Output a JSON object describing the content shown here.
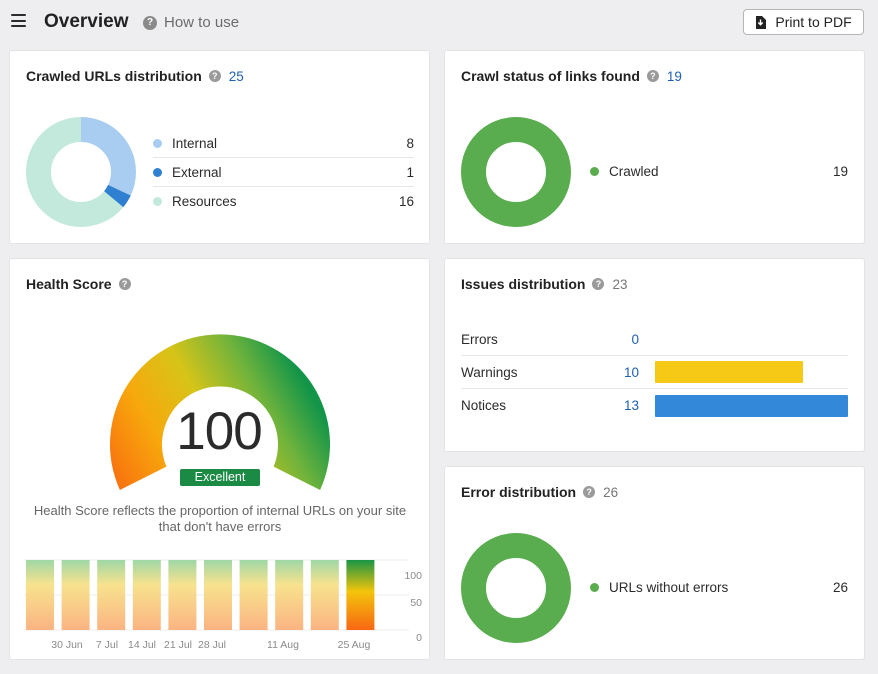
{
  "header": {
    "title": "Overview",
    "how_to_use": "How to use",
    "print_label": "Print to PDF"
  },
  "crawled_urls": {
    "title": "Crawled URLs distribution",
    "total": "25",
    "items": [
      {
        "label": "Internal",
        "value": "8",
        "color": "#a9cdf0"
      },
      {
        "label": "External",
        "value": "1",
        "color": "#2f80d1"
      },
      {
        "label": "Resources",
        "value": "16",
        "color": "#c3e8dc"
      }
    ]
  },
  "crawl_status": {
    "title": "Crawl status of links found",
    "total": "19",
    "items": [
      {
        "label": "Crawled",
        "value": "19",
        "color": "#5aad4e"
      }
    ]
  },
  "health_score": {
    "title": "Health Score",
    "score": "100",
    "badge": "Excellent",
    "badge_color": "#1a8a45",
    "description": "Health Score reflects the proportion of internal URLs on your site that don't have errors",
    "history": [
      100,
      100,
      100,
      100,
      100,
      100,
      100,
      100,
      100,
      100
    ],
    "x_ticks": [
      "30 Jun",
      "7 Jul",
      "14 Jul",
      "21 Jul",
      "28 Jul",
      "11 Aug",
      "25 Aug"
    ],
    "y_ticks": [
      "100",
      "50",
      "0"
    ]
  },
  "issues": {
    "title": "Issues distribution",
    "total": "23",
    "rows": [
      {
        "label": "Errors",
        "value": "0",
        "fraction": 0,
        "color": "#e05a3a"
      },
      {
        "label": "Warnings",
        "value": "10",
        "fraction": 0.769,
        "color": "#f7c917"
      },
      {
        "label": "Notices",
        "value": "13",
        "fraction": 1.0,
        "color": "#3388d9"
      }
    ]
  },
  "error_distribution": {
    "title": "Error distribution",
    "total": "26",
    "items": [
      {
        "label": "URLs without errors",
        "value": "26",
        "color": "#5aad4e"
      }
    ]
  }
}
